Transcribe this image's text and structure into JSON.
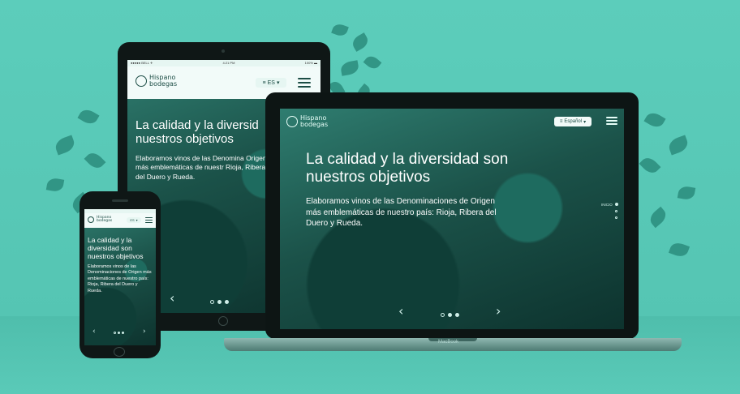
{
  "brand": {
    "line1": "Hispano",
    "line2": "bodegas"
  },
  "hero": {
    "title": "La calidad y la diversidad son nuestros objetivos",
    "text": "Elaboramos vinos de las Denominaciones de Origen más emblemáticas de nuestro país: Rioja, Ribera del Duero y Rueda."
  },
  "tablet": {
    "status_left": "●●●●● BELL ✈",
    "status_time": "4:21 PM",
    "status_right": "100% ▬",
    "language": "ES",
    "title": "La calidad y la diversid nuestros objetivos",
    "text": "Elaboramos vinos de las Denomina Origen más emblemáticas de nuestr Rioja, Ribera del Duero y Rueda."
  },
  "laptop": {
    "language": "Español",
    "side_label": "INICIO",
    "brand_badge": "MacBook"
  },
  "phone": {
    "language": "ES"
  },
  "colors": {
    "background": "#58c8b6",
    "accent": "#1c4d45"
  }
}
